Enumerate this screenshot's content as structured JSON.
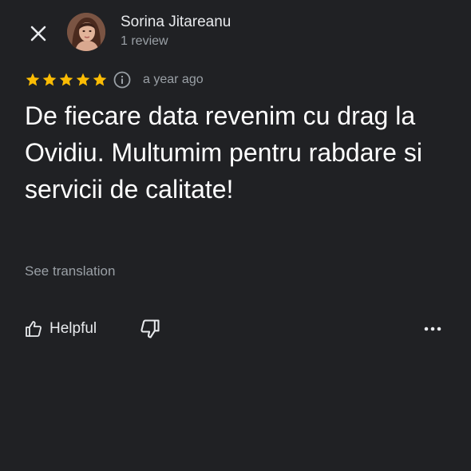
{
  "reviewer": {
    "name": "Sorina Jitareanu",
    "review_count": "1 review",
    "avatar_icon": "profile-photo"
  },
  "review": {
    "rating": 5,
    "max_rating": 5,
    "time_ago": "a year ago",
    "text": "De fiecare data revenim cu drag la Ovidiu. Multumim pentru rabdare si servicii de calitate!",
    "see_translation": "See translation"
  },
  "actions": {
    "helpful_label": "Helpful",
    "close_icon": "close-icon",
    "like_icon": "thumbs-up-icon",
    "dislike_icon": "thumbs-down-icon",
    "more_icon": "more-horizontal-icon"
  },
  "colors": {
    "background": "#202124",
    "star": "#fbbc04",
    "primary_text": "#ffffff",
    "secondary_text": "#9aa0a6"
  }
}
